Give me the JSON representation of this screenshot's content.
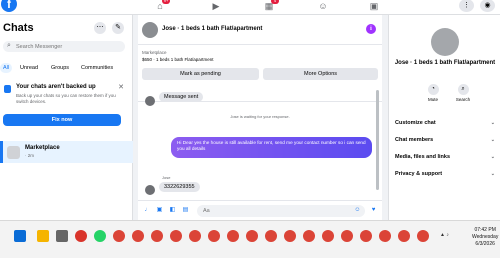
{
  "topnav": {
    "logo": "f",
    "badge_1": "9+",
    "badge_2": "4"
  },
  "sidebar": {
    "title": "Chats",
    "more_icon": "⋯",
    "compose_icon": "✎",
    "search_placeholder": "Search Messenger",
    "filters": [
      "All",
      "Unread",
      "Groups",
      "Communities"
    ],
    "backup": {
      "title": "Your chats aren't backed up",
      "text": "Back up your chats so you can restore them if you switch devices.",
      "button": "Fix now"
    },
    "conversation": {
      "name": "Marketplace",
      "time": "· 2m"
    }
  },
  "conversation": {
    "title": "Jose · 1 beds 1 bath Flat/apartment",
    "info_icon": "i",
    "listing": {
      "label": "Marketplace",
      "price": "$650 · 1 beds 1 bath Flat/apartment",
      "mark_pending": "Mark as pending",
      "more_options": "More Options"
    },
    "messages": {
      "system": "Message sent",
      "waiting": "Jose is waiting for your response.",
      "outgoing": "Hi Dear yes the house is still available for rent, send me your contact number so i can send you all details",
      "sender": "Jose",
      "incoming": "3322629355"
    },
    "composer": {
      "placeholder": "Aa"
    }
  },
  "right_panel": {
    "title": "Jose · 1 beds 1 bath Flat/apartment",
    "actions": [
      "Mute",
      "Search"
    ],
    "rows": [
      "Customize chat",
      "Chat members",
      "Media, files and links",
      "Privacy & support"
    ]
  },
  "taskbar": {
    "time": "07:42 PM",
    "day": "Wednesday",
    "date": "6/3/2026"
  }
}
